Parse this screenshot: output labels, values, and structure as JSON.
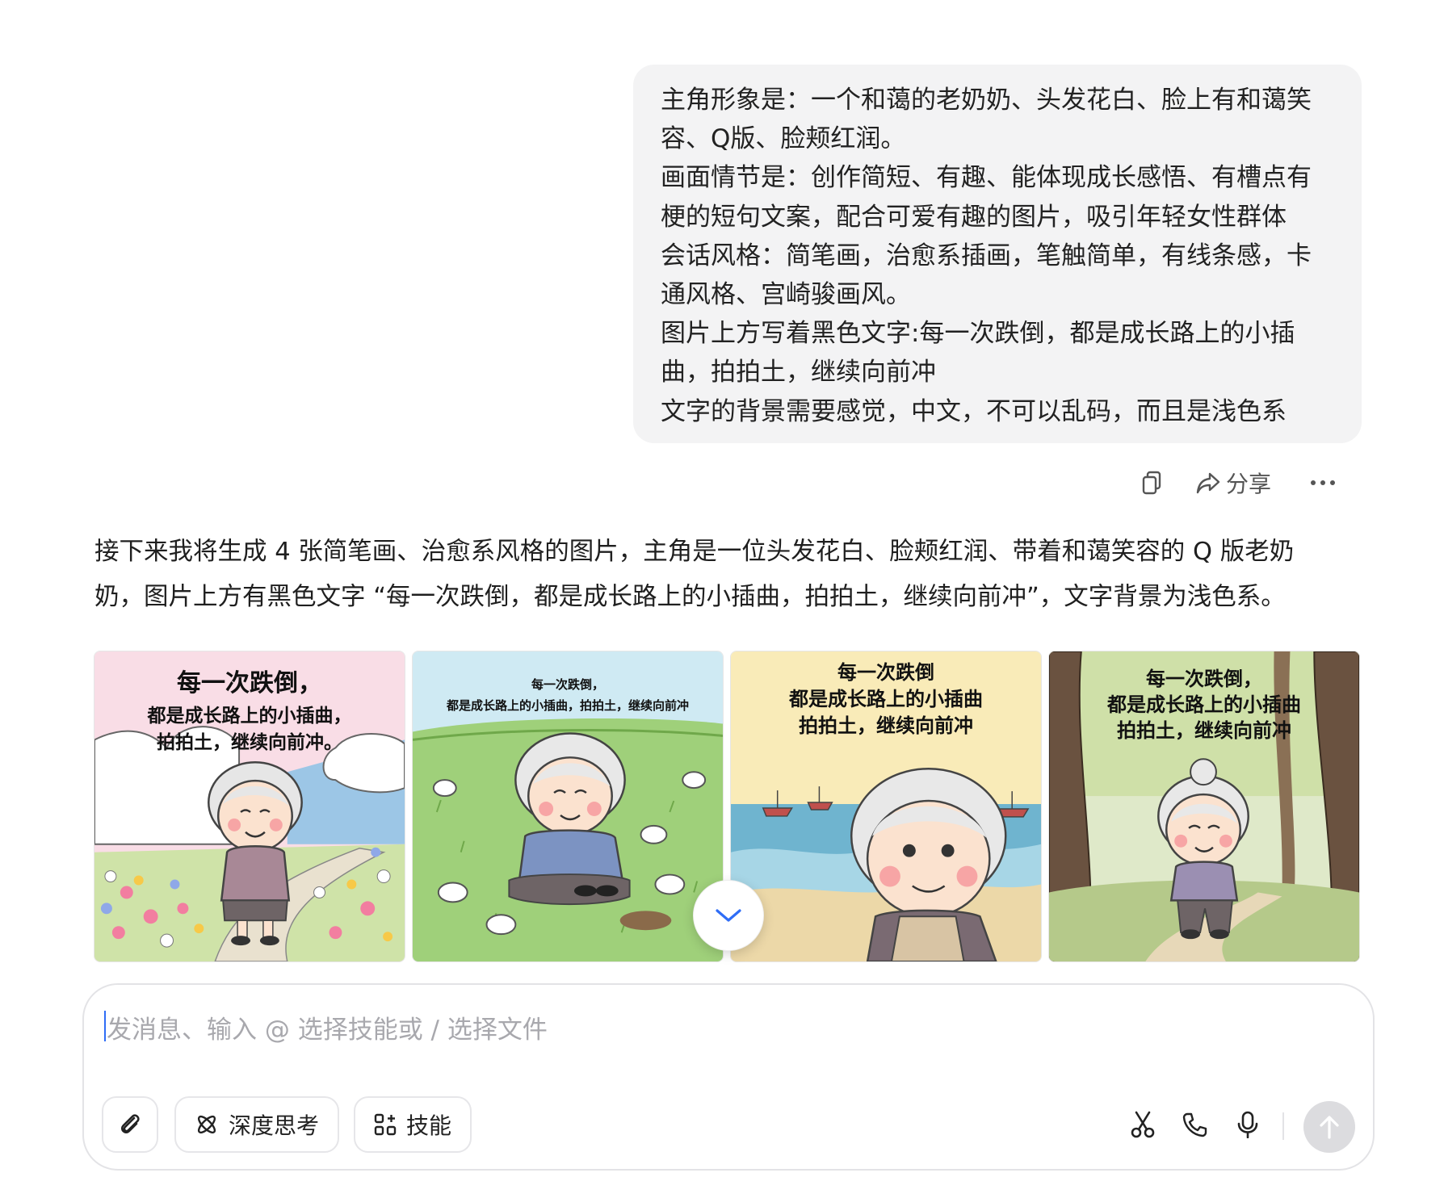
{
  "user_message": {
    "lines": [
      "主角形象是：一个和蔼的老奶奶、头发花白、脸上有和蔼笑",
      "容、Q版、脸颊红润。",
      "画面情节是：创作简短、有趣、能体现成长感悟、有槽点有",
      "梗的短句文案，配合可爱有趣的图片，吸引年轻女性群体",
      "会话风格：简笔画，治愈系插画，笔触简单，有线条感，卡",
      "通风格、宫崎骏画风。",
      "图片上方写着黑色文字:每一次跌倒，都是成长路上的小插",
      "曲，拍拍土，继续向前冲",
      "文字的背景需要感觉，中文，不可以乱码，而且是浅色系"
    ]
  },
  "message_actions": {
    "copy_icon": "copy-icon",
    "share_label": "分享",
    "share_icon": "share-icon",
    "more_icon": "more-icon"
  },
  "assistant_reply": {
    "lines": [
      "接下来我将生成 4 张简笔画、治愈系风格的图片，主角是一位头发花白、脸颊红润、带着和蔼笑容的 Q 版老奶",
      "奶，图片上方有黑色文字 “每一次跌倒，都是成长路上的小插曲，拍拍土，继续向前冲”，文字背景为浅色系。"
    ]
  },
  "images": [
    {
      "caption_lines": [
        "每一次跌倒，",
        "都是成长路上的小插曲，",
        "拍拍土，继续向前冲。"
      ],
      "background": "#f9dde6",
      "scene": "flower path with clouds"
    },
    {
      "caption_lines": [
        "每一次跌倒，",
        "都是成长路上的小插曲，拍拍土，继续向前冲"
      ],
      "background": "#cfeaf3",
      "scene": "grass field with rabbits"
    },
    {
      "caption_lines": [
        "每一次跌倒",
        "都是成长路上的小插曲",
        "拍拍土，继续向前冲"
      ],
      "background": "#f9ebb8",
      "scene": "seaside with boats"
    },
    {
      "caption_lines": [
        "每一次跌倒，",
        "都是成长路上的小插曲",
        "拍拍土，继续向前冲"
      ],
      "background": "#dfe9c9",
      "scene": "forest path"
    }
  ],
  "scroll_down_icon": "chevron-down-icon",
  "composer": {
    "placeholder": "发消息、输入 @ 选择技能或 / 选择文件",
    "attach_icon": "paperclip-icon",
    "deep_think_label": "深度思考",
    "deep_think_icon": "atom-icon",
    "skills_label": "技能",
    "skills_icon": "grid-plus-icon",
    "scissors_icon": "scissors-icon",
    "phone_icon": "phone-icon",
    "mic_icon": "microphone-icon",
    "send_icon": "arrow-up-icon"
  },
  "colors": {
    "accent": "#2f6df6",
    "bubble_bg": "#f3f3f4",
    "send_disabled": "#dcdcdf"
  }
}
